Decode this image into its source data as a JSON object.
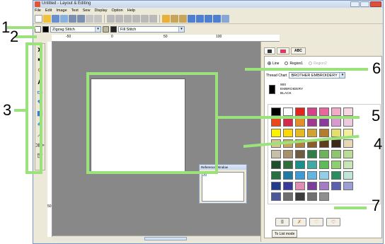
{
  "window": {
    "title": "Untitled - Layout & Editing"
  },
  "menu": [
    "File",
    "Edit",
    "Image",
    "Text",
    "Sew",
    "Display",
    "Option",
    "Help"
  ],
  "toolbar2": {
    "line_stitch": "Zigzag Stitch",
    "fill_stitch": "Fill Stitch"
  },
  "ruler_marks": [
    "-50",
    "0",
    "50",
    "100"
  ],
  "ruler_left_marks": [
    "50"
  ],
  "reference_window": {
    "title": "Reference Window"
  },
  "panel": {
    "tab_abc": "ABC",
    "radio_line": "Line",
    "radio_region1": "Region1",
    "radio_region2": "Region2",
    "thread_chart_label": "Thread Chart",
    "thread_chart_value": "BROTHER EMBROIDERY",
    "thread_number": "900",
    "thread_brand": "EMBROIDERY",
    "thread_color_name": "BLACK",
    "to_list_mode": "To List mode"
  },
  "colors": {
    "callout": "#9be27c",
    "canvas_bg": "#888888",
    "palette": [
      "#000000",
      "#ffffff",
      "#e2261e",
      "#d9418a",
      "#e7669c",
      "#f4a9c7",
      "#f8d6e2",
      "#e8491b",
      "#d42a4d",
      "#e38f2a",
      "#a13a8e",
      "#8a3a9c",
      "#d69ad0",
      "#f0c9e0",
      "#fff200",
      "#ffd800",
      "#e6b91f",
      "#d3a32f",
      "#b47c2b",
      "#e4df6b",
      "#f5ef9a",
      "#d6c58d",
      "#c9a660",
      "#b28040",
      "#8b5d2b",
      "#5e3d1f",
      "#3b2a1a",
      "#e6d8b6",
      "#c8bfa8",
      "#a8916a",
      "#6f5b3f",
      "#2e7e45",
      "#6db35a",
      "#8dc66c",
      "#b9dc97",
      "#1f4e2c",
      "#2f6e3a",
      "#1b8f8a",
      "#3fa9a3",
      "#5dbb5a",
      "#8fcf72",
      "#c8e5b6",
      "#27703f",
      "#1e7ba5",
      "#3d9bd6",
      "#62b6e1",
      "#93cde8",
      "#2a8d5f",
      "#bfe4d8",
      "#233d8a",
      "#3a3a9c",
      "#e08db5",
      "#7a3f9b",
      "#a57bc6",
      "#5a5fb0",
      "#9c9ed6",
      "#4b5899",
      "#6f6f6f",
      "#3c3c3c",
      "#707070",
      "#8f8f8f"
    ]
  },
  "callouts": [
    "1",
    "2",
    "3",
    "4",
    "5",
    "6",
    "7"
  ]
}
